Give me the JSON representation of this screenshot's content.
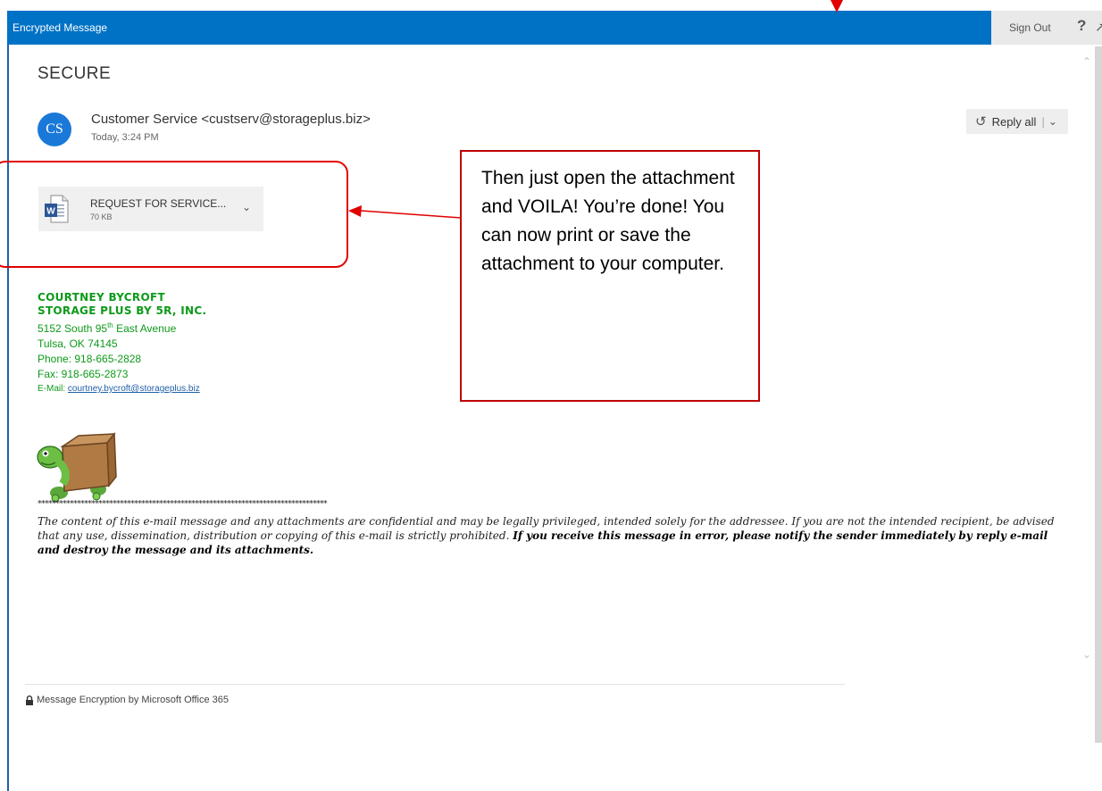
{
  "window": {
    "title": "Encrypted Message",
    "sign_out_label": "Sign Out",
    "help_label": "?"
  },
  "message": {
    "subject": "SECURE",
    "sender_initials": "CS",
    "sender": "Customer Service <custserv@storageplus.biz>",
    "sent_time": "Today, 3:24 PM",
    "reply_all_label": "Reply all"
  },
  "attachment": {
    "name": "REQUEST FOR SERVICE...",
    "size": "70 KB",
    "icon": "word-document-icon"
  },
  "callout": {
    "text": "Then just open the attachment and VOILA! You’re done! You can now print or save the attachment to your computer."
  },
  "signature": {
    "name": "Courtney Bycroft",
    "company": "Storage Plus by 5R, Inc.",
    "address_prefix": "5152 South 95",
    "address_sup": "th",
    "address_suffix": " East Avenue",
    "city": "Tulsa, OK 74145",
    "phone": "Phone: 918-665-2828",
    "fax": "Fax: 918-665-2873",
    "email_label": "E-Mail: ",
    "email": "courtney.bycroft@storageplus.biz"
  },
  "disclaimer": {
    "stars": "*********************************************************************************",
    "normal": "The content of this e-mail message and any attachments are confidential and may be legally privileged, intended solely for the addressee. If you are not the intended recipient, be advised that any use, dissemination, distribution or copying of this e-mail is strictly prohibited. ",
    "bold": "If you receive this message in error, please notify the sender immediately by reply e-mail and destroy the message and its attachments."
  },
  "footer": {
    "text": "Message Encryption by Microsoft Office 365"
  },
  "colors": {
    "topbar": "#0072c6",
    "avatar": "#1a79d8",
    "signature_green": "#0e9a1a",
    "annotation_red": "#e00000"
  }
}
